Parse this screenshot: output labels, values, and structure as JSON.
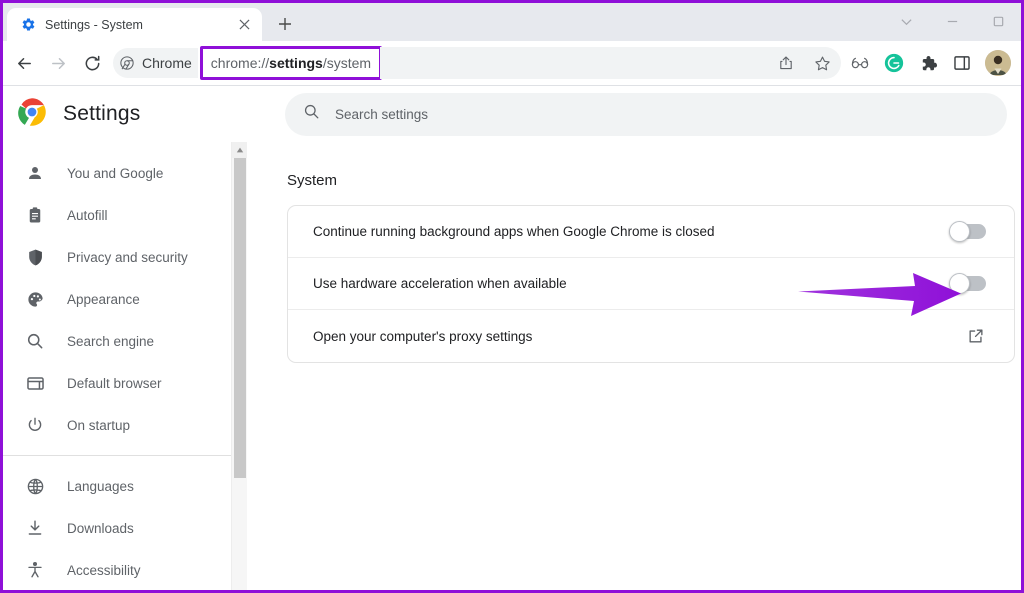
{
  "window": {
    "controls": [
      {
        "name": "tab-search",
        "glyph": "tab-search-chevron-icon"
      },
      {
        "name": "minimize",
        "glyph": "minimize-icon"
      },
      {
        "name": "maximize",
        "glyph": "maximize-icon"
      }
    ]
  },
  "tabstrip": {
    "tab_title": "Settings - System",
    "favicon": "settings-gear-favicon",
    "close_label": "×",
    "newtab_label": "+"
  },
  "toolbar": {
    "back_label": "←",
    "forward_label": "→",
    "reload_label": "⟳",
    "chrome_chip_label": "Chrome",
    "url_prefix": "chrome://",
    "url_bold": "settings",
    "url_suffix": "/system",
    "icons": [
      {
        "name": "share-icon"
      },
      {
        "name": "bookmark-star-icon"
      },
      {
        "name": "reading-glasses-icon"
      },
      {
        "name": "grammarly-extension-icon",
        "color": "#15c39a"
      },
      {
        "name": "extensions-puzzle-icon"
      },
      {
        "name": "side-panel-icon"
      },
      {
        "name": "profile-avatar"
      }
    ]
  },
  "settings": {
    "title": "Settings",
    "logo": "chrome-logo-icon",
    "search": {
      "placeholder": "Search settings",
      "icon": "search-icon",
      "value": ""
    }
  },
  "sidebar": {
    "groups": [
      {
        "items": [
          {
            "label": "You and Google",
            "icon": "person-icon"
          },
          {
            "label": "Autofill",
            "icon": "clipboard-icon"
          },
          {
            "label": "Privacy and security",
            "icon": "shield-icon"
          },
          {
            "label": "Appearance",
            "icon": "palette-icon"
          },
          {
            "label": "Search engine",
            "icon": "search-icon"
          },
          {
            "label": "Default browser",
            "icon": "browser-window-icon"
          },
          {
            "label": "On startup",
            "icon": "power-icon"
          }
        ]
      },
      {
        "items": [
          {
            "label": "Languages",
            "icon": "globe-icon"
          },
          {
            "label": "Downloads",
            "icon": "download-icon"
          },
          {
            "label": "Accessibility",
            "icon": "accessibility-icon"
          }
        ]
      }
    ],
    "scrollbar": {
      "up_arrow": "▲"
    }
  },
  "main": {
    "section_title": "System",
    "rows": [
      {
        "label": "Continue running background apps when Google Chrome is closed",
        "control": "toggle",
        "state": "off"
      },
      {
        "label": "Use hardware acceleration when available",
        "control": "toggle",
        "state": "off"
      },
      {
        "label": "Open your computer's proxy settings",
        "control": "external-link",
        "state": ""
      }
    ]
  },
  "annotation": {
    "type": "arrow",
    "color": "#8f10d8",
    "points_to": "Use hardware acceleration when available toggle"
  },
  "colors": {
    "highlight_purple": "#8f10d8",
    "tabstrip_bg": "#e7e9ee",
    "omnibox_bg": "#f1f3f4",
    "text_primary": "#202124",
    "text_secondary": "#5f6368",
    "toggle_off": "#bdc1c6"
  }
}
